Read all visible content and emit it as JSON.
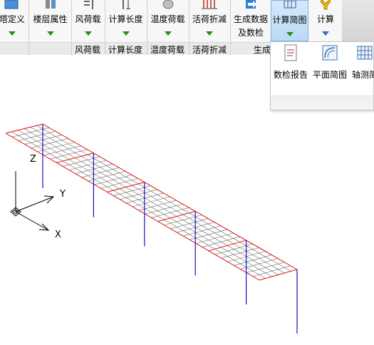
{
  "ribbon": {
    "buttons": [
      {
        "name": "tower-definition-button",
        "label": "塔定义",
        "icon": "tower-definition-icon"
      },
      {
        "name": "floor-properties-button",
        "label": "楼层属性",
        "icon": "floor-properties-icon"
      },
      {
        "name": "wind-load-button",
        "label": "风荷载",
        "icon": "wind-load-icon"
      },
      {
        "name": "calc-length-button",
        "label": "计算长度",
        "icon": "calc-length-icon"
      },
      {
        "name": "temperature-load-button",
        "label": "温度荷载",
        "icon": "temperature-load-icon"
      },
      {
        "name": "live-load-reduction-button",
        "label": "活荷折减",
        "icon": "live-load-reduction-icon"
      },
      {
        "name": "generate-data-button",
        "label": "生成数据",
        "label2": "及数检",
        "icon": "generate-data-icon"
      },
      {
        "name": "calc-diagram-button",
        "label": "计算简图",
        "icon": "calc-diagram-icon"
      },
      {
        "name": "calculate-button",
        "label": "计算",
        "icon": "calculate-icon"
      }
    ],
    "groups": [
      "风荷载",
      "计算长度",
      "温度荷载",
      "活荷折减",
      "生成"
    ]
  },
  "dropdown": {
    "items": [
      {
        "label": "数检报告",
        "icon": "check-report-icon"
      },
      {
        "label": "平面简图",
        "icon": "plan-diagram-icon"
      },
      {
        "label": "轴测简",
        "icon": "axonometric-diagram-icon"
      }
    ]
  },
  "viewport": {
    "axes": {
      "x": "X",
      "y": "Y",
      "z": "Z"
    },
    "colors": {
      "slab_grid": "#6b6b6b",
      "slab_border": "#dd1111",
      "columns": "#1010c8"
    }
  }
}
